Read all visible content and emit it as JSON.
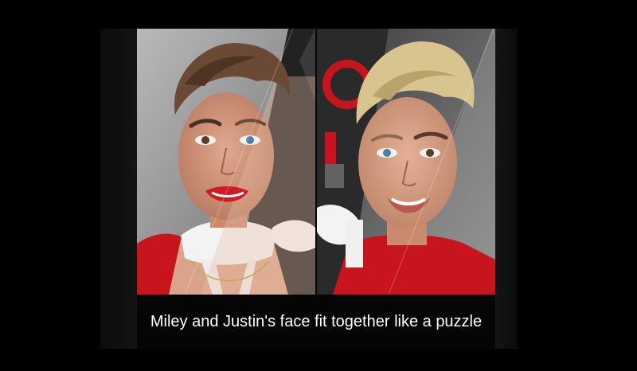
{
  "caption": {
    "text": "Miley and Justin's face fit together like a puzzle"
  },
  "colors": {
    "background": "#000000",
    "dress_red": "#c8141c",
    "skin": "#c99076",
    "hair_brown": "#6a4a34",
    "hair_blonde": "#d8c48e",
    "backdrop_gray": "#8a8a8a"
  },
  "images": {
    "left": {
      "name": "left-composite-photo"
    },
    "right": {
      "name": "right-composite-photo"
    }
  }
}
